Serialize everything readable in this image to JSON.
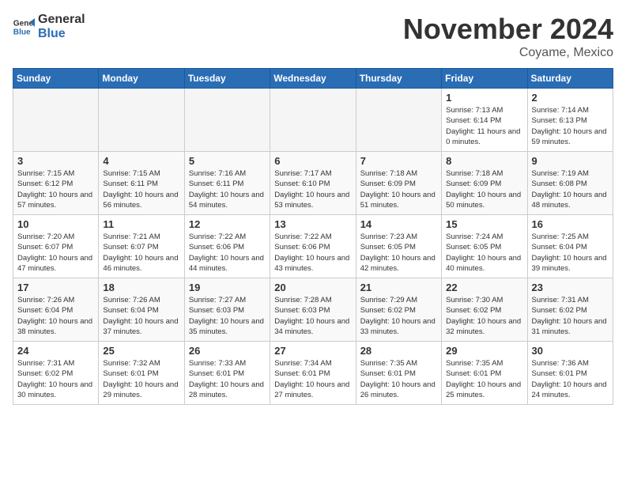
{
  "header": {
    "logo_line1": "General",
    "logo_line2": "Blue",
    "month_title": "November 2024",
    "location": "Coyame, Mexico"
  },
  "weekdays": [
    "Sunday",
    "Monday",
    "Tuesday",
    "Wednesday",
    "Thursday",
    "Friday",
    "Saturday"
  ],
  "weeks": [
    [
      {
        "day": "",
        "empty": true
      },
      {
        "day": "",
        "empty": true
      },
      {
        "day": "",
        "empty": true
      },
      {
        "day": "",
        "empty": true
      },
      {
        "day": "",
        "empty": true
      },
      {
        "day": "1",
        "sunrise": "Sunrise: 7:13 AM",
        "sunset": "Sunset: 6:14 PM",
        "daylight": "Daylight: 11 hours and 0 minutes."
      },
      {
        "day": "2",
        "sunrise": "Sunrise: 7:14 AM",
        "sunset": "Sunset: 6:13 PM",
        "daylight": "Daylight: 10 hours and 59 minutes."
      }
    ],
    [
      {
        "day": "3",
        "sunrise": "Sunrise: 7:15 AM",
        "sunset": "Sunset: 6:12 PM",
        "daylight": "Daylight: 10 hours and 57 minutes."
      },
      {
        "day": "4",
        "sunrise": "Sunrise: 7:15 AM",
        "sunset": "Sunset: 6:11 PM",
        "daylight": "Daylight: 10 hours and 56 minutes."
      },
      {
        "day": "5",
        "sunrise": "Sunrise: 7:16 AM",
        "sunset": "Sunset: 6:11 PM",
        "daylight": "Daylight: 10 hours and 54 minutes."
      },
      {
        "day": "6",
        "sunrise": "Sunrise: 7:17 AM",
        "sunset": "Sunset: 6:10 PM",
        "daylight": "Daylight: 10 hours and 53 minutes."
      },
      {
        "day": "7",
        "sunrise": "Sunrise: 7:18 AM",
        "sunset": "Sunset: 6:09 PM",
        "daylight": "Daylight: 10 hours and 51 minutes."
      },
      {
        "day": "8",
        "sunrise": "Sunrise: 7:18 AM",
        "sunset": "Sunset: 6:09 PM",
        "daylight": "Daylight: 10 hours and 50 minutes."
      },
      {
        "day": "9",
        "sunrise": "Sunrise: 7:19 AM",
        "sunset": "Sunset: 6:08 PM",
        "daylight": "Daylight: 10 hours and 48 minutes."
      }
    ],
    [
      {
        "day": "10",
        "sunrise": "Sunrise: 7:20 AM",
        "sunset": "Sunset: 6:07 PM",
        "daylight": "Daylight: 10 hours and 47 minutes."
      },
      {
        "day": "11",
        "sunrise": "Sunrise: 7:21 AM",
        "sunset": "Sunset: 6:07 PM",
        "daylight": "Daylight: 10 hours and 46 minutes."
      },
      {
        "day": "12",
        "sunrise": "Sunrise: 7:22 AM",
        "sunset": "Sunset: 6:06 PM",
        "daylight": "Daylight: 10 hours and 44 minutes."
      },
      {
        "day": "13",
        "sunrise": "Sunrise: 7:22 AM",
        "sunset": "Sunset: 6:06 PM",
        "daylight": "Daylight: 10 hours and 43 minutes."
      },
      {
        "day": "14",
        "sunrise": "Sunrise: 7:23 AM",
        "sunset": "Sunset: 6:05 PM",
        "daylight": "Daylight: 10 hours and 42 minutes."
      },
      {
        "day": "15",
        "sunrise": "Sunrise: 7:24 AM",
        "sunset": "Sunset: 6:05 PM",
        "daylight": "Daylight: 10 hours and 40 minutes."
      },
      {
        "day": "16",
        "sunrise": "Sunrise: 7:25 AM",
        "sunset": "Sunset: 6:04 PM",
        "daylight": "Daylight: 10 hours and 39 minutes."
      }
    ],
    [
      {
        "day": "17",
        "sunrise": "Sunrise: 7:26 AM",
        "sunset": "Sunset: 6:04 PM",
        "daylight": "Daylight: 10 hours and 38 minutes."
      },
      {
        "day": "18",
        "sunrise": "Sunrise: 7:26 AM",
        "sunset": "Sunset: 6:04 PM",
        "daylight": "Daylight: 10 hours and 37 minutes."
      },
      {
        "day": "19",
        "sunrise": "Sunrise: 7:27 AM",
        "sunset": "Sunset: 6:03 PM",
        "daylight": "Daylight: 10 hours and 35 minutes."
      },
      {
        "day": "20",
        "sunrise": "Sunrise: 7:28 AM",
        "sunset": "Sunset: 6:03 PM",
        "daylight": "Daylight: 10 hours and 34 minutes."
      },
      {
        "day": "21",
        "sunrise": "Sunrise: 7:29 AM",
        "sunset": "Sunset: 6:02 PM",
        "daylight": "Daylight: 10 hours and 33 minutes."
      },
      {
        "day": "22",
        "sunrise": "Sunrise: 7:30 AM",
        "sunset": "Sunset: 6:02 PM",
        "daylight": "Daylight: 10 hours and 32 minutes."
      },
      {
        "day": "23",
        "sunrise": "Sunrise: 7:31 AM",
        "sunset": "Sunset: 6:02 PM",
        "daylight": "Daylight: 10 hours and 31 minutes."
      }
    ],
    [
      {
        "day": "24",
        "sunrise": "Sunrise: 7:31 AM",
        "sunset": "Sunset: 6:02 PM",
        "daylight": "Daylight: 10 hours and 30 minutes."
      },
      {
        "day": "25",
        "sunrise": "Sunrise: 7:32 AM",
        "sunset": "Sunset: 6:01 PM",
        "daylight": "Daylight: 10 hours and 29 minutes."
      },
      {
        "day": "26",
        "sunrise": "Sunrise: 7:33 AM",
        "sunset": "Sunset: 6:01 PM",
        "daylight": "Daylight: 10 hours and 28 minutes."
      },
      {
        "day": "27",
        "sunrise": "Sunrise: 7:34 AM",
        "sunset": "Sunset: 6:01 PM",
        "daylight": "Daylight: 10 hours and 27 minutes."
      },
      {
        "day": "28",
        "sunrise": "Sunrise: 7:35 AM",
        "sunset": "Sunset: 6:01 PM",
        "daylight": "Daylight: 10 hours and 26 minutes."
      },
      {
        "day": "29",
        "sunrise": "Sunrise: 7:35 AM",
        "sunset": "Sunset: 6:01 PM",
        "daylight": "Daylight: 10 hours and 25 minutes."
      },
      {
        "day": "30",
        "sunrise": "Sunrise: 7:36 AM",
        "sunset": "Sunset: 6:01 PM",
        "daylight": "Daylight: 10 hours and 24 minutes."
      }
    ]
  ]
}
